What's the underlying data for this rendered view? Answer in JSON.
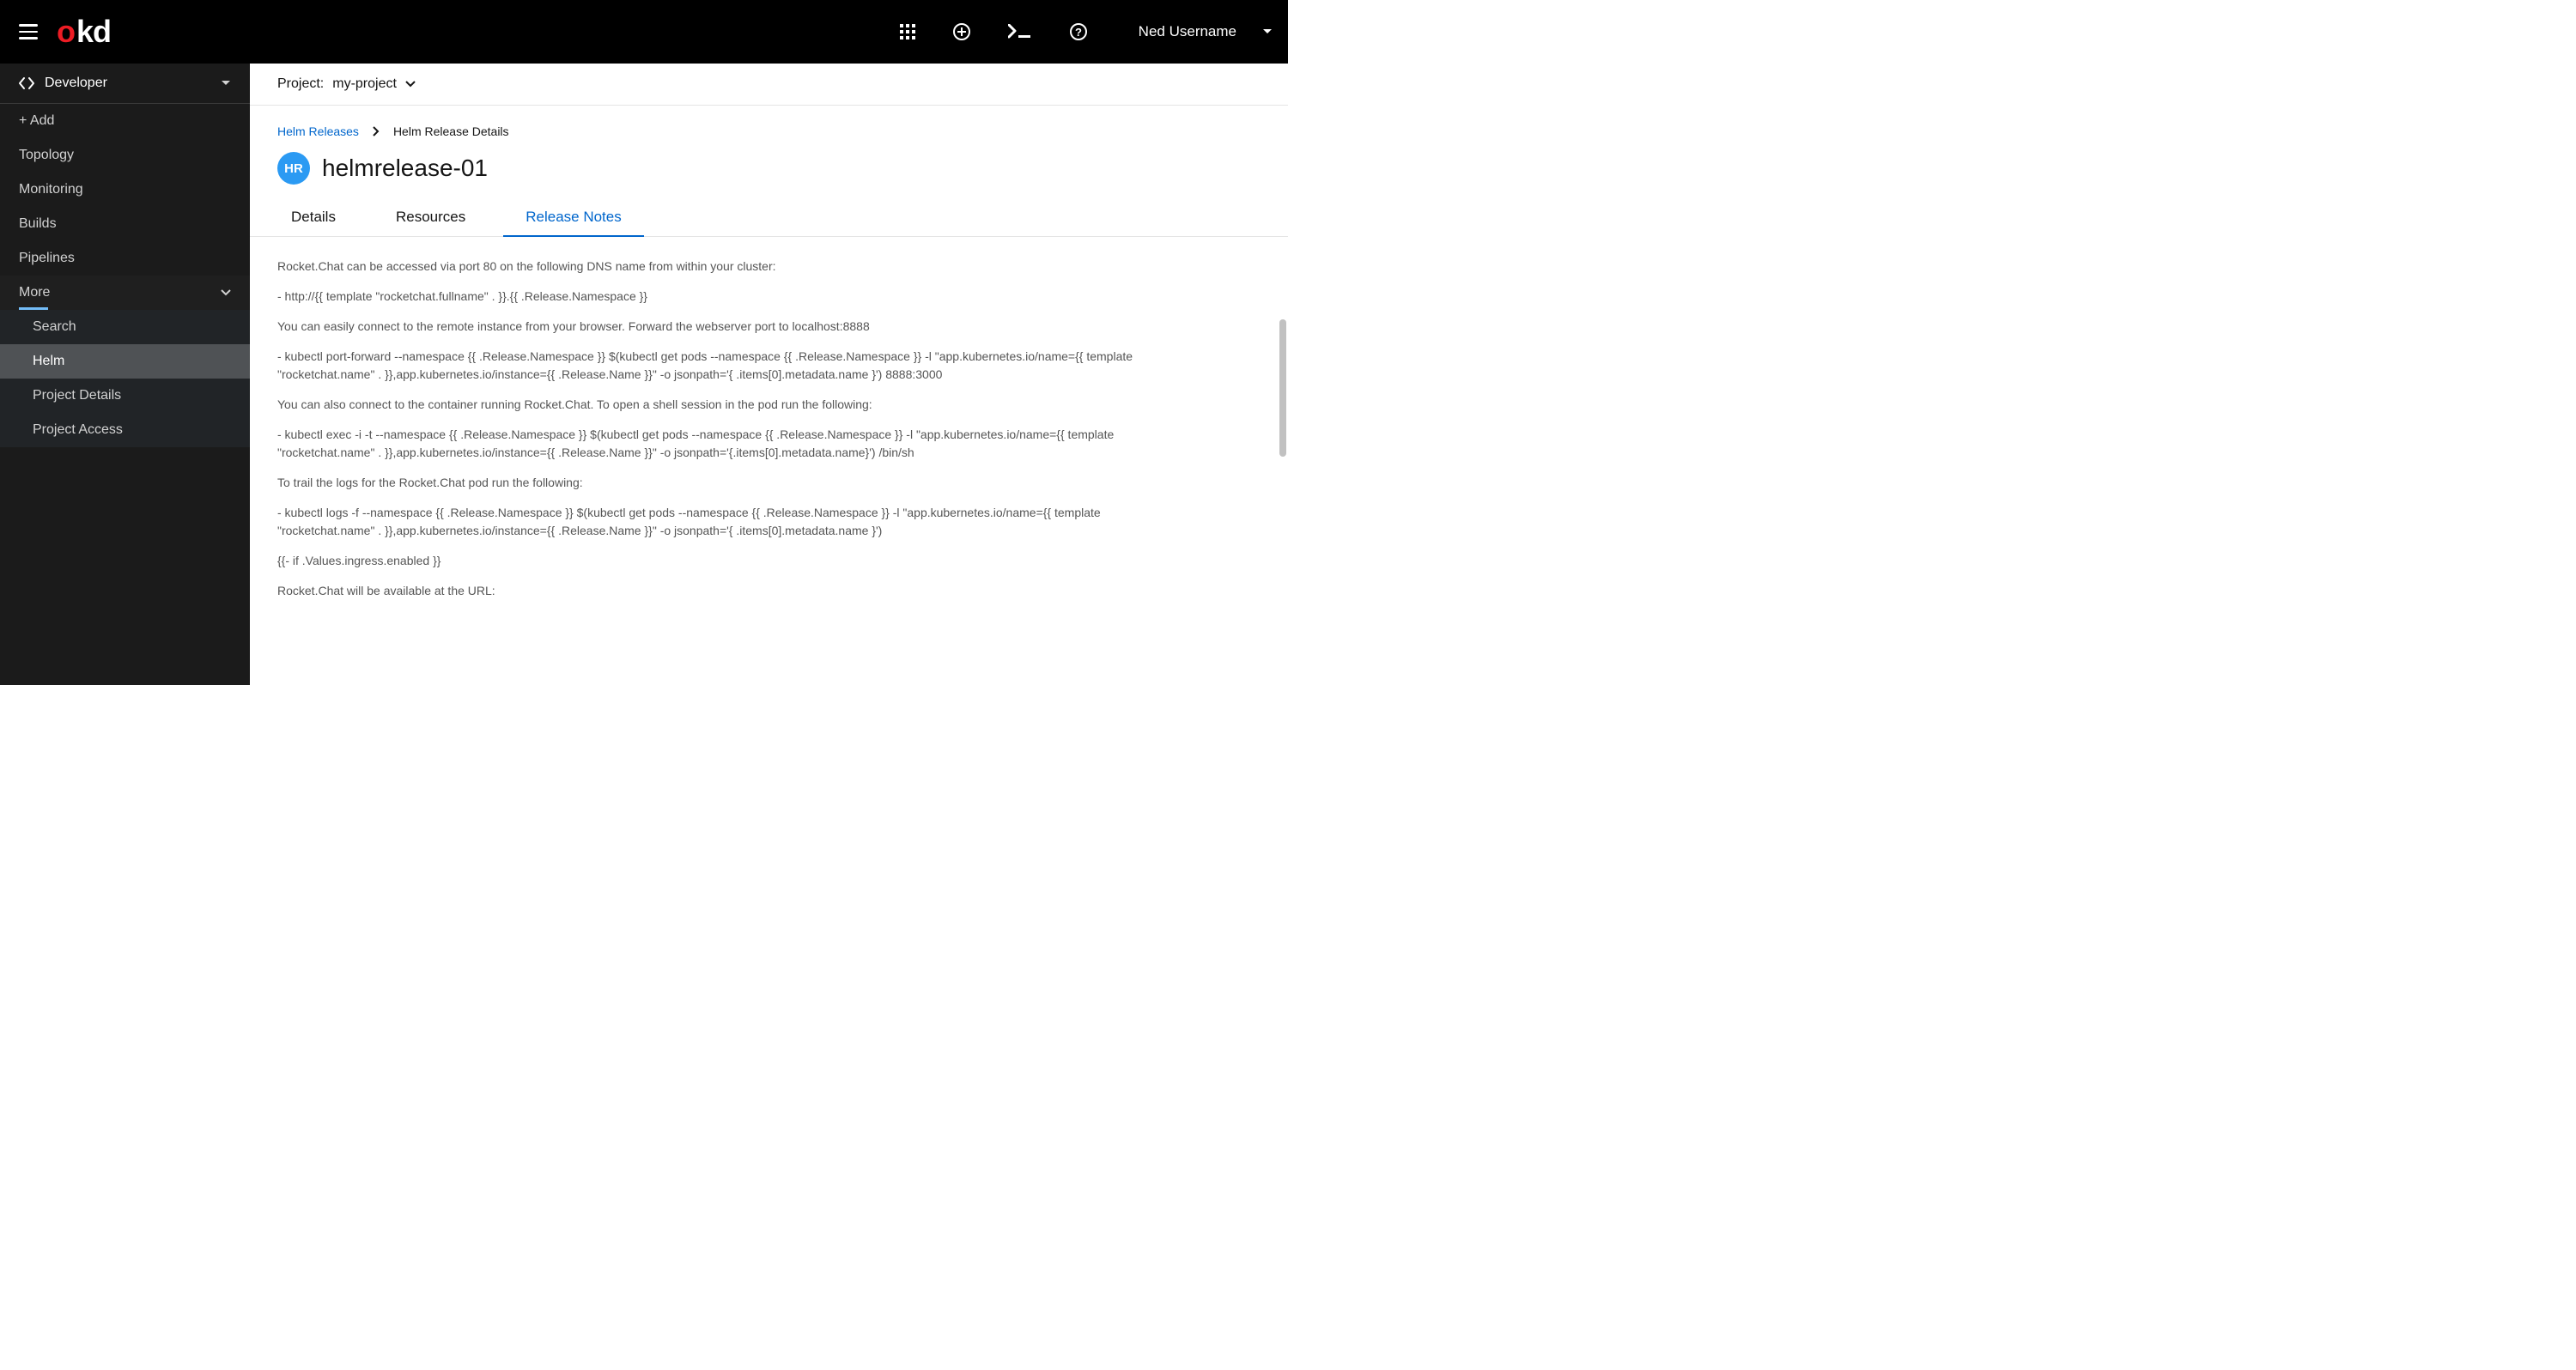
{
  "header": {
    "username": "Ned Username"
  },
  "perspective": {
    "label": "Developer"
  },
  "sidebar": {
    "items": [
      {
        "label": "+ Add"
      },
      {
        "label": "Topology"
      },
      {
        "label": "Monitoring"
      },
      {
        "label": "Builds"
      },
      {
        "label": "Pipelines"
      }
    ],
    "more_label": "More",
    "subitems": [
      {
        "label": "Search"
      },
      {
        "label": "Helm"
      },
      {
        "label": "Project Details"
      },
      {
        "label": "Project Access"
      }
    ]
  },
  "project_bar": {
    "label": "Project:",
    "value": "my-project"
  },
  "breadcrumbs": {
    "parent": "Helm Releases",
    "current": "Helm Release Details"
  },
  "page": {
    "badge": "HR",
    "title": "helmrelease-01"
  },
  "tabs": [
    {
      "label": "Details"
    },
    {
      "label": "Resources"
    },
    {
      "label": "Release Notes"
    }
  ],
  "notes": {
    "p1": "Rocket.Chat can be accessed via port 80 on the following DNS name from within your cluster:",
    "p2": "- http://{{ template \"rocketchat.fullname\" . }}.{{ .Release.Namespace }}",
    "p3": "You can easily connect to the remote instance from your browser. Forward the webserver port to localhost:8888",
    "p4": "- kubectl port-forward --namespace {{ .Release.Namespace }} $(kubectl get pods --namespace {{ .Release.Namespace }} -l \"app.kubernetes.io/name={{ template \"rocketchat.name\" . }},app.kubernetes.io/instance={{ .Release.Name }}\" -o jsonpath='{ .items[0].metadata.name }') 8888:3000",
    "p5": "You can also connect to the container running Rocket.Chat. To open a shell session in the pod run the following:",
    "p6": "- kubectl exec -i -t --namespace {{ .Release.Namespace }} $(kubectl get pods --namespace {{ .Release.Namespace }} -l \"app.kubernetes.io/name={{ template \"rocketchat.name\" . }},app.kubernetes.io/instance={{ .Release.Name }}\" -o jsonpath='{.items[0].metadata.name}') /bin/sh",
    "p7": "To trail the logs for the Rocket.Chat pod run the following:",
    "p8": "- kubectl logs -f --namespace {{ .Release.Namespace }} $(kubectl get pods --namespace {{ .Release.Namespace }} -l \"app.kubernetes.io/name={{ template \"rocketchat.name\" . }},app.kubernetes.io/instance={{ .Release.Name }}\" -o jsonpath='{ .items[0].metadata.name }')",
    "p9": "{{- if .Values.ingress.enabled }}",
    "p10": "Rocket.Chat will be available at the URL:"
  }
}
